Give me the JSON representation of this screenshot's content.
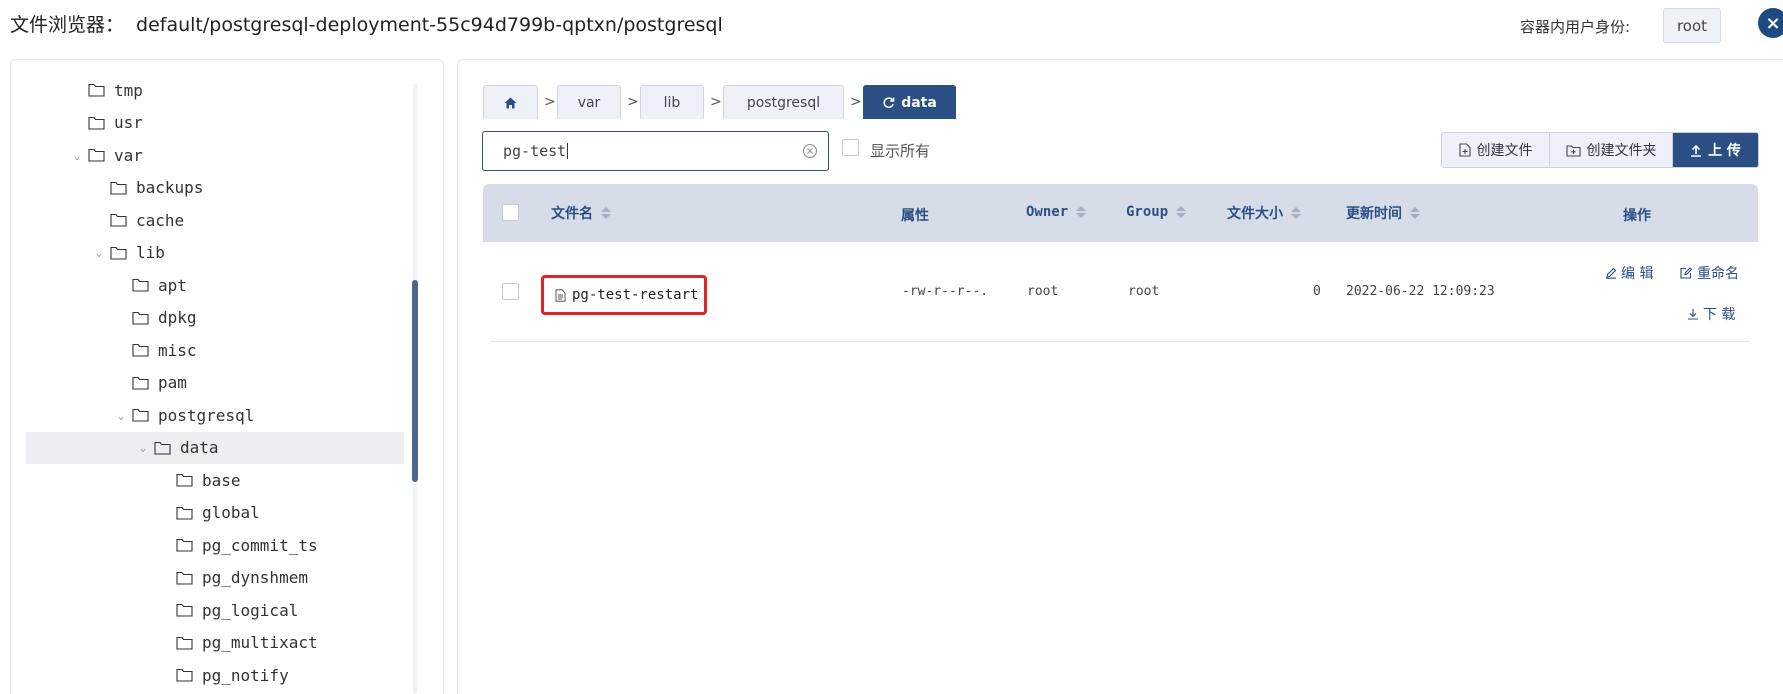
{
  "header": {
    "label": "文件浏览器：",
    "path": "default/postgresql-deployment-55c94d799b-qptxn/postgresql",
    "user_label": "容器内用户身份:",
    "user_value": "root",
    "close_icon": "×"
  },
  "tree": {
    "items": [
      {
        "label": "tmp",
        "toggle": ""
      },
      {
        "label": "usr",
        "toggle": ""
      },
      {
        "label": "var",
        "toggle": "⌄"
      },
      {
        "label": "backups",
        "toggle": ""
      },
      {
        "label": "cache",
        "toggle": ""
      },
      {
        "label": "lib",
        "toggle": "⌄"
      },
      {
        "label": "apt",
        "toggle": ""
      },
      {
        "label": "dpkg",
        "toggle": ""
      },
      {
        "label": "misc",
        "toggle": ""
      },
      {
        "label": "pam",
        "toggle": ""
      },
      {
        "label": "postgresql",
        "toggle": "⌄"
      },
      {
        "label": "data",
        "toggle": "⌄"
      },
      {
        "label": "base",
        "toggle": ""
      },
      {
        "label": "global",
        "toggle": ""
      },
      {
        "label": "pg_commit_ts",
        "toggle": ""
      },
      {
        "label": "pg_dynshmem",
        "toggle": ""
      },
      {
        "label": "pg_logical",
        "toggle": ""
      },
      {
        "label": "pg_multixact",
        "toggle": ""
      },
      {
        "label": "pg_notify",
        "toggle": ""
      }
    ]
  },
  "breadcrumb": {
    "items": [
      "var",
      "lib",
      "postgresql"
    ],
    "current": "data",
    "sep": ">"
  },
  "toolbar": {
    "search_value": "pg-test",
    "show_all_label": "显示所有",
    "create_file": "创建文件",
    "create_folder": "创建文件夹",
    "upload": "上 传"
  },
  "table": {
    "columns": {
      "name": "文件名",
      "attr": "属性",
      "owner": "Owner",
      "group": "Group",
      "size": "文件大小",
      "mtime": "更新时间",
      "ops": "操作"
    },
    "rows": [
      {
        "name": "pg-test-restart",
        "attr": "-rw-r--r--.",
        "owner": "root",
        "group": "root",
        "size": "0",
        "mtime": "2022-06-22 12:09:23",
        "op_edit": "编 辑",
        "op_rename": "重命名",
        "op_download": "下 载"
      }
    ]
  }
}
